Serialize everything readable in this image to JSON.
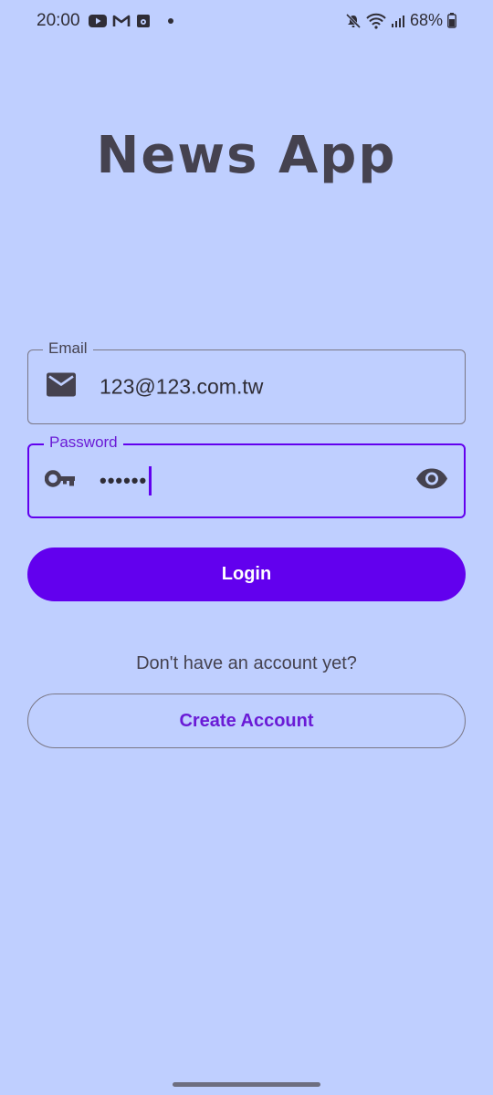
{
  "status_bar": {
    "time": "20:00",
    "battery": "68%",
    "left_icons": [
      "youtube-icon",
      "gmail-icon",
      "media-icon",
      "dot-icon"
    ],
    "right_icons": [
      "mute-icon",
      "wifi-icon",
      "signal-icon",
      "battery-icon"
    ]
  },
  "title": "News App",
  "email_field": {
    "label": "Email",
    "value": "123@123.com.tw",
    "icon": "mail-icon"
  },
  "password_field": {
    "label": "Password",
    "value": "••••••",
    "icon": "key-icon",
    "toggle_icon": "eye-icon"
  },
  "login_button": {
    "label": "Login"
  },
  "signup_prompt": "Don't have an account yet?",
  "create_account_button": {
    "label": "Create Account"
  },
  "colors": {
    "background": "#bfcfff",
    "primary": "#6200ee",
    "text": "#45424f"
  }
}
